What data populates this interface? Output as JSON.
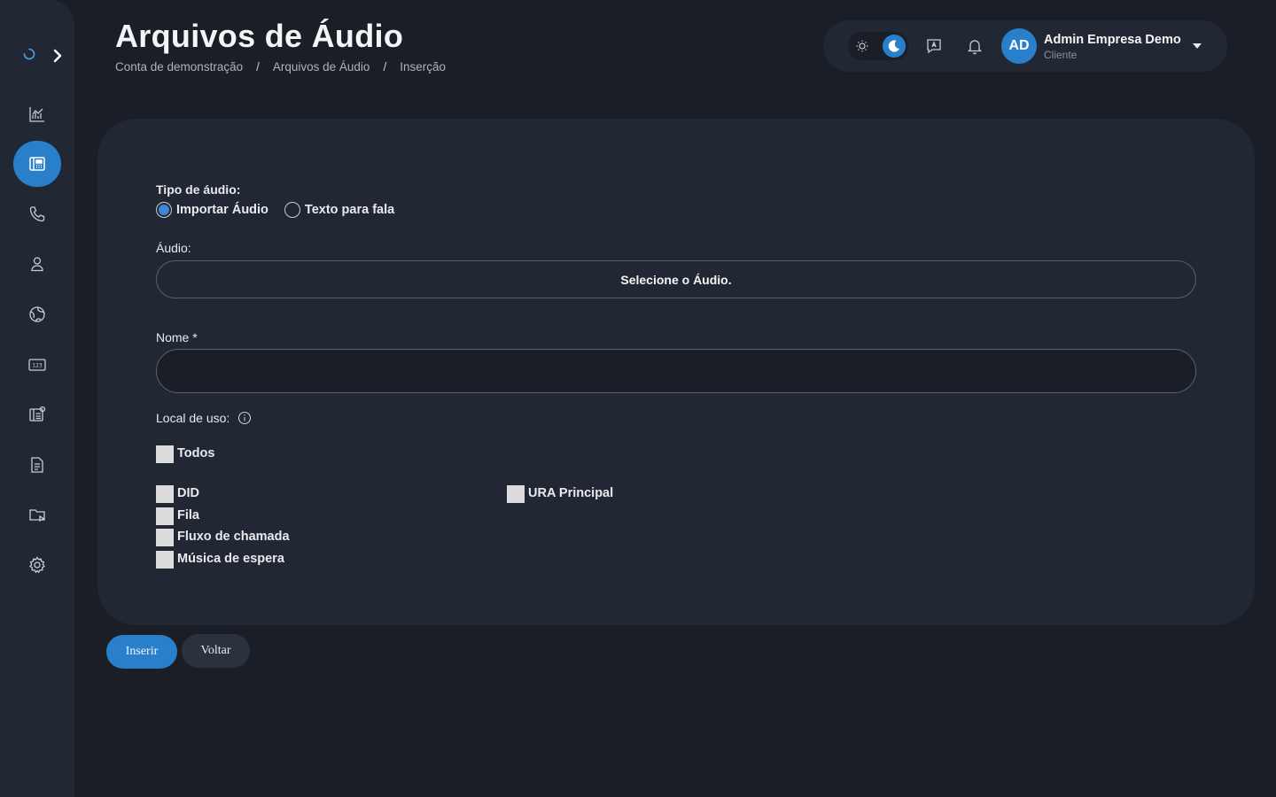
{
  "header": {
    "title": "Arquivos de Áudio",
    "breadcrumb": [
      "Conta de demonstração",
      "Arquivos de Áudio",
      "Inserção"
    ],
    "breadcrumb_separator": "/"
  },
  "user": {
    "initials": "AD",
    "name": "Admin Empresa Demo",
    "role": "Cliente"
  },
  "colors": {
    "accent": "#2a7fcb",
    "background": "#1a1e27",
    "surface": "#222833"
  },
  "sidebar": {
    "items": [
      {
        "icon": "chart-icon"
      },
      {
        "icon": "switchboard-icon",
        "active": true
      },
      {
        "icon": "phone-icon"
      },
      {
        "icon": "user-icon"
      },
      {
        "icon": "globe-icon"
      },
      {
        "icon": "number-123-icon"
      },
      {
        "icon": "settings-panel-icon"
      },
      {
        "icon": "document-icon"
      },
      {
        "icon": "folder-play-icon"
      },
      {
        "icon": "gear-icon"
      }
    ]
  },
  "form": {
    "audio_type_label": "Tipo de áudio:",
    "audio_type_options": [
      "Importar Áudio",
      "Texto para fala"
    ],
    "audio_type_selected": "Importar Áudio",
    "audio_label": "Áudio:",
    "audio_button": "Selecione o Áudio.",
    "name_label": "Nome *",
    "name_value": "",
    "usage_label": "Local de uso:",
    "usage_all": "Todos",
    "usage_options_col1": [
      "DID",
      "Fila",
      "Fluxo de chamada",
      "Música de espera"
    ],
    "usage_options_col2": [
      "URA Principal"
    ]
  },
  "actions": {
    "insert": "Inserir",
    "back": "Voltar"
  }
}
